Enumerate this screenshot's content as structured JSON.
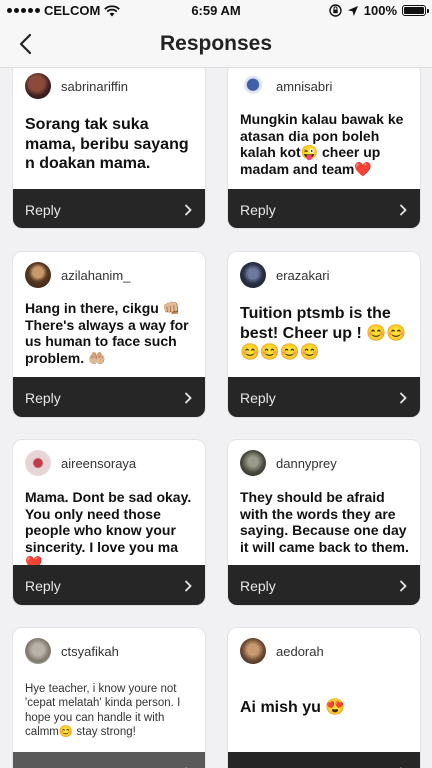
{
  "status": {
    "carrier": "CELCOM",
    "time": "6:59 AM",
    "battery": "100%"
  },
  "nav": {
    "title": "Responses"
  },
  "reply_label": "Reply",
  "cards": [
    {
      "username": "sabrinariffin",
      "text": "Sorang tak suka mama, beribu sayang n doakan mama."
    },
    {
      "username": "amnisabri",
      "text": "Mungkin kalau bawak ke atasan dia pon boleh kalah kot😜 cheer up madam and team❤️"
    },
    {
      "username": "azilahanim_",
      "text": "Hang in there, cikgu 👊🏼 There's always a way for us human to face such problem. 🤲🏼"
    },
    {
      "username": "erazakari",
      "text": "Tuition ptsmb is the best! Cheer up ! 😊😊😊😊😊😊"
    },
    {
      "username": "aireensoraya",
      "text": "Mama. Dont be sad okay. You only need those people who know your sincerity. I love you ma ❤️"
    },
    {
      "username": "dannyprey",
      "text": "They should be afraid with the words they are saying. Because one day it will came back to them."
    },
    {
      "username": "ctsyafikah",
      "text": "Hye teacher, i know youre not 'cepat melatah' kinda person. I hope you can handle it with calmm😊 stay strong!"
    },
    {
      "username": "aedorah",
      "text": "Ai mish yu 😍"
    }
  ]
}
